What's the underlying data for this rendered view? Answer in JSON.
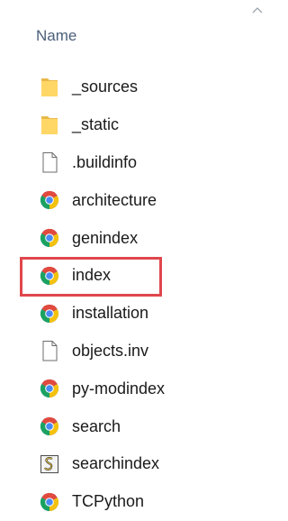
{
  "column_header": {
    "label": "Name",
    "sort_icon": "chevron-up-icon"
  },
  "files": [
    {
      "name": "_sources",
      "icon": "folder-icon",
      "type": "folder"
    },
    {
      "name": "_static",
      "icon": "folder-icon",
      "type": "folder"
    },
    {
      "name": ".buildinfo",
      "icon": "blank-file-icon",
      "type": "file"
    },
    {
      "name": "architecture",
      "icon": "chrome-html-icon",
      "type": "html"
    },
    {
      "name": "genindex",
      "icon": "chrome-html-icon",
      "type": "html"
    },
    {
      "name": "index",
      "icon": "chrome-html-icon",
      "type": "html",
      "highlighted": true
    },
    {
      "name": "installation",
      "icon": "chrome-html-icon",
      "type": "html"
    },
    {
      "name": "objects.inv",
      "icon": "blank-file-icon",
      "type": "file"
    },
    {
      "name": "py-modindex",
      "icon": "chrome-html-icon",
      "type": "html"
    },
    {
      "name": "search",
      "icon": "chrome-html-icon",
      "type": "html"
    },
    {
      "name": "searchindex",
      "icon": "script-file-icon",
      "type": "script"
    },
    {
      "name": "TCPython",
      "icon": "chrome-html-icon",
      "type": "html"
    }
  ],
  "colors": {
    "highlight_border": "#e0474c",
    "header_text": "#4c607a",
    "folder": "#ffd766"
  }
}
